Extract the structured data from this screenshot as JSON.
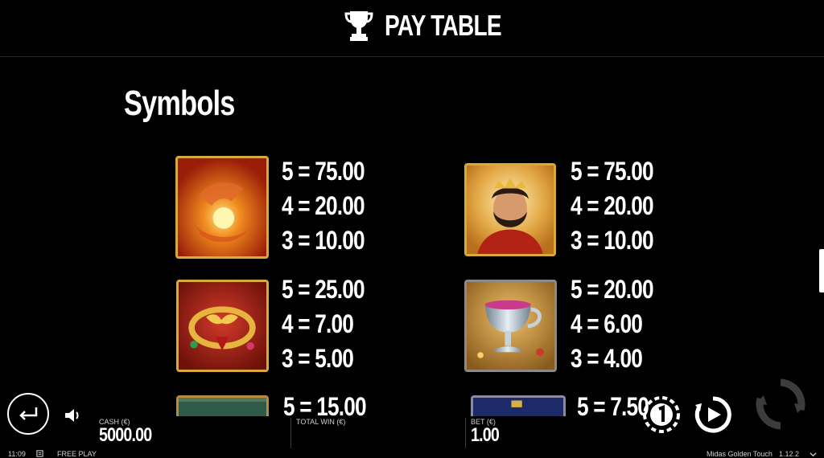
{
  "header": {
    "title": "PAY TABLE",
    "icon": "trophy-icon"
  },
  "section": {
    "title": "Symbols"
  },
  "symbols": [
    {
      "name": "golden-hands-symbol",
      "pays": [
        "5 = 75.00",
        "4 = 20.00",
        "3 = 10.00"
      ]
    },
    {
      "name": "king-midas-symbol",
      "pays": [
        "5 = 75.00",
        "4 = 20.00",
        "3 = 10.00"
      ]
    },
    {
      "name": "golden-necklace-symbol",
      "pays": [
        "5 = 25.00",
        "4 = 7.00",
        "3 = 5.00"
      ]
    },
    {
      "name": "silver-goblet-symbol",
      "pays": [
        "5 = 20.00",
        "4 = 6.00",
        "3 = 4.00"
      ]
    },
    {
      "name": "green-symbol-partial",
      "pays": [
        "5 = 15.00"
      ]
    },
    {
      "name": "blue-symbol-partial",
      "pays": [
        "5 = 7.50"
      ]
    }
  ],
  "bottom_bar": {
    "cash_label": "CASH (€)",
    "cash_value": "5000.00",
    "total_win_label": "TOTAL WIN (€)",
    "total_win_value": "",
    "bet_label": "BET (€)",
    "bet_value": "1.00"
  },
  "status": {
    "time": "11:09",
    "mode": "FREE PLAY",
    "game_name": "Midas Golden Touch",
    "version": "1.12.2"
  },
  "colors": {
    "background": "#000000",
    "gold_border": "#d9a93a",
    "text": "#ffffff"
  }
}
